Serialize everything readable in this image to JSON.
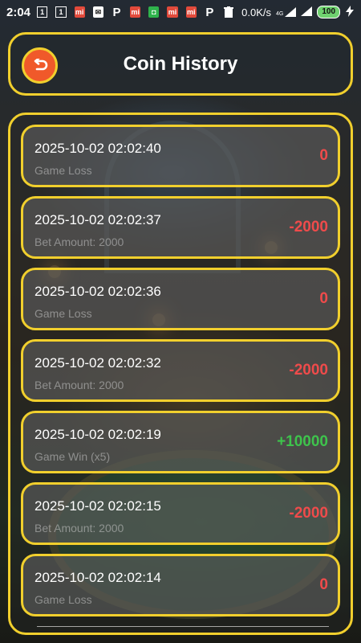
{
  "status_bar": {
    "time": "2:04",
    "icons": [
      "sim1-icon",
      "sim1-icon",
      "mi-icon",
      "mail-icon",
      "p-icon",
      "mi-icon",
      "green-app-icon",
      "mi-icon",
      "mi-icon",
      "p-icon",
      "trash-icon"
    ],
    "network_speed": "0.0K/s",
    "network_type": "4G",
    "battery": "100"
  },
  "header": {
    "title": "Coin History",
    "back_icon": "return-arrow-icon"
  },
  "colors": {
    "accent_border": "#f1cf2d",
    "back_button": "#f0592a",
    "positive": "#3ec34c",
    "negative": "#ef4b4b"
  },
  "transactions": [
    {
      "timestamp": "2025-10-02 02:02:40",
      "description": "Game Loss",
      "amount": "0",
      "kind": "negative"
    },
    {
      "timestamp": "2025-10-02 02:02:37",
      "description": "Bet Amount: 2000",
      "amount": "-2000",
      "kind": "negative"
    },
    {
      "timestamp": "2025-10-02 02:02:36",
      "description": "Game Loss",
      "amount": "0",
      "kind": "negative"
    },
    {
      "timestamp": "2025-10-02 02:02:32",
      "description": "Bet Amount: 2000",
      "amount": "-2000",
      "kind": "negative"
    },
    {
      "timestamp": "2025-10-02 02:02:19",
      "description": "Game Win (x5)",
      "amount": "+10000",
      "kind": "positive"
    },
    {
      "timestamp": "2025-10-02 02:02:15",
      "description": "Bet Amount: 2000",
      "amount": "-2000",
      "kind": "negative"
    },
    {
      "timestamp": "2025-10-02 02:02:14",
      "description": "Game Loss",
      "amount": "0",
      "kind": "negative"
    }
  ]
}
